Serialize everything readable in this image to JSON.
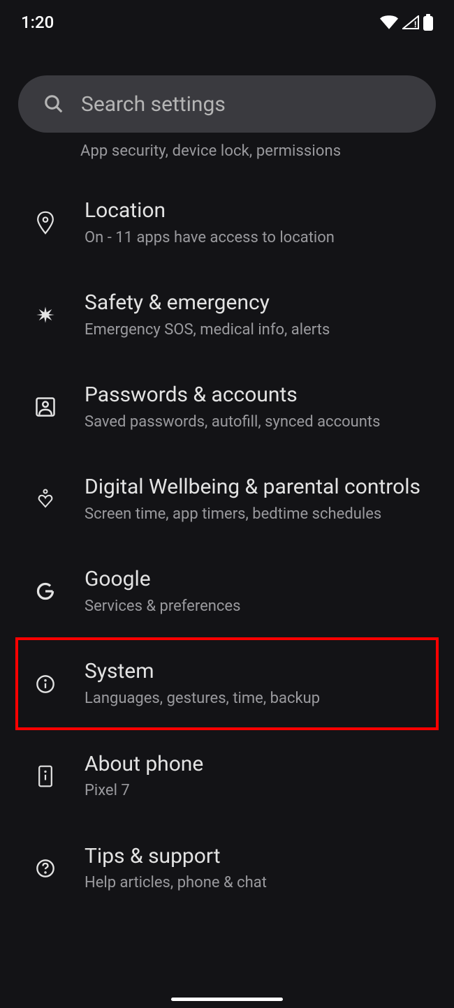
{
  "status": {
    "time": "1:20"
  },
  "search": {
    "placeholder": "Search settings"
  },
  "partial": {
    "subtitle": "App security, device lock, permissions"
  },
  "items": [
    {
      "title": "Location",
      "subtitle": "On - 11 apps have access to location",
      "icon": "location"
    },
    {
      "title": "Safety & emergency",
      "subtitle": "Emergency SOS, medical info, alerts",
      "icon": "asterisk"
    },
    {
      "title": "Passwords & accounts",
      "subtitle": "Saved passwords, autofill, synced accounts",
      "icon": "account-box"
    },
    {
      "title": "Digital Wellbeing & parental controls",
      "subtitle": "Screen time, app timers, bedtime schedules",
      "icon": "heart"
    },
    {
      "title": "Google",
      "subtitle": "Services & preferences",
      "icon": "google"
    },
    {
      "title": "System",
      "subtitle": "Languages, gestures, time, backup",
      "icon": "info",
      "highlight": true
    },
    {
      "title": "About phone",
      "subtitle": "Pixel 7",
      "icon": "phone-info"
    },
    {
      "title": "Tips & support",
      "subtitle": "Help articles, phone & chat",
      "icon": "help"
    }
  ]
}
